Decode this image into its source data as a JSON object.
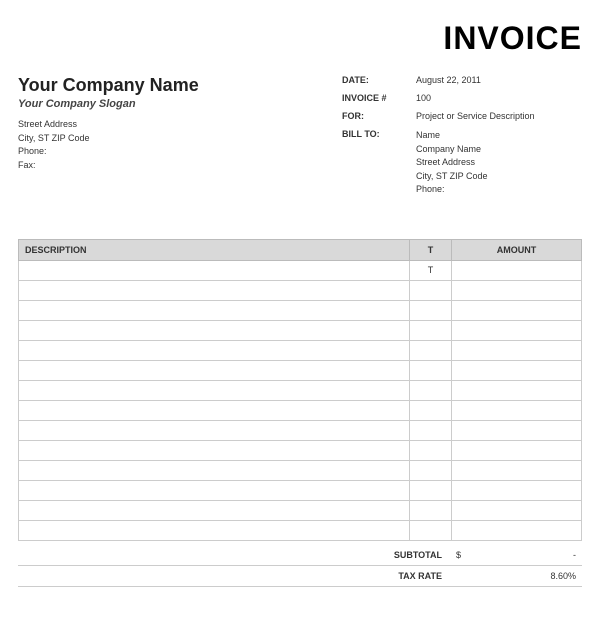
{
  "title": "INVOICE",
  "company": {
    "name": "Your Company Name",
    "slogan": "Your Company Slogan"
  },
  "from": {
    "street": "Street Address",
    "citystzip": "City, ST  ZIP Code",
    "phone_label": "Phone:",
    "fax_label": "Fax:"
  },
  "meta": {
    "date_label": "DATE:",
    "date_value": "August 22, 2011",
    "invoice_num_label": "INVOICE #",
    "invoice_num_value": "100",
    "for_label": "FOR:",
    "for_value": "Project or Service Description",
    "billto_label": "BILL TO:"
  },
  "billto": {
    "name": "Name",
    "company": "Company Name",
    "street": "Street Address",
    "citystzip": "City, ST  ZIP Code",
    "phone_label": "Phone:"
  },
  "table": {
    "headers": {
      "description": "DESCRIPTION",
      "t": "T",
      "amount": "AMOUNT"
    },
    "rows": [
      {
        "description": "",
        "t": "T",
        "amount": ""
      },
      {
        "description": "",
        "t": "",
        "amount": ""
      },
      {
        "description": "",
        "t": "",
        "amount": ""
      },
      {
        "description": "",
        "t": "",
        "amount": ""
      },
      {
        "description": "",
        "t": "",
        "amount": ""
      },
      {
        "description": "",
        "t": "",
        "amount": ""
      },
      {
        "description": "",
        "t": "",
        "amount": ""
      },
      {
        "description": "",
        "t": "",
        "amount": ""
      },
      {
        "description": "",
        "t": "",
        "amount": ""
      },
      {
        "description": "",
        "t": "",
        "amount": ""
      },
      {
        "description": "",
        "t": "",
        "amount": ""
      },
      {
        "description": "",
        "t": "",
        "amount": ""
      },
      {
        "description": "",
        "t": "",
        "amount": ""
      },
      {
        "description": "",
        "t": "",
        "amount": ""
      }
    ]
  },
  "totals": {
    "subtotal_label": "SUBTOTAL",
    "subtotal_currency": "$",
    "subtotal_value": "-",
    "taxrate_label": "TAX RATE",
    "taxrate_value": "8.60%"
  }
}
